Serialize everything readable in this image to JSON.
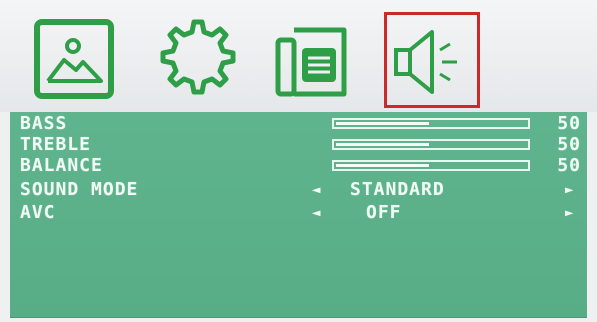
{
  "tabs": [
    {
      "icon": "picture-icon",
      "selected": false
    },
    {
      "icon": "gear-icon",
      "selected": false
    },
    {
      "icon": "document-icon",
      "selected": false
    },
    {
      "icon": "speaker-icon",
      "selected": true
    }
  ],
  "colors": {
    "icon_green": "#2e9f47",
    "selection_red": "#cc2a2a",
    "panel_green": "#5fb48d",
    "text": "#f1fbf6"
  },
  "settings": {
    "bass": {
      "label": "BASS",
      "value": "50",
      "level": 0.5
    },
    "treble": {
      "label": "TREBLE",
      "value": "50",
      "level": 0.5
    },
    "balance": {
      "label": "BALANCE",
      "value": "50",
      "level": 0.5
    },
    "sound_mode": {
      "label": "SOUND MODE",
      "value": "STANDARD"
    },
    "avc": {
      "label": "AVC",
      "value": "OFF"
    }
  },
  "arrows": {
    "left": "◄",
    "right": "►"
  }
}
